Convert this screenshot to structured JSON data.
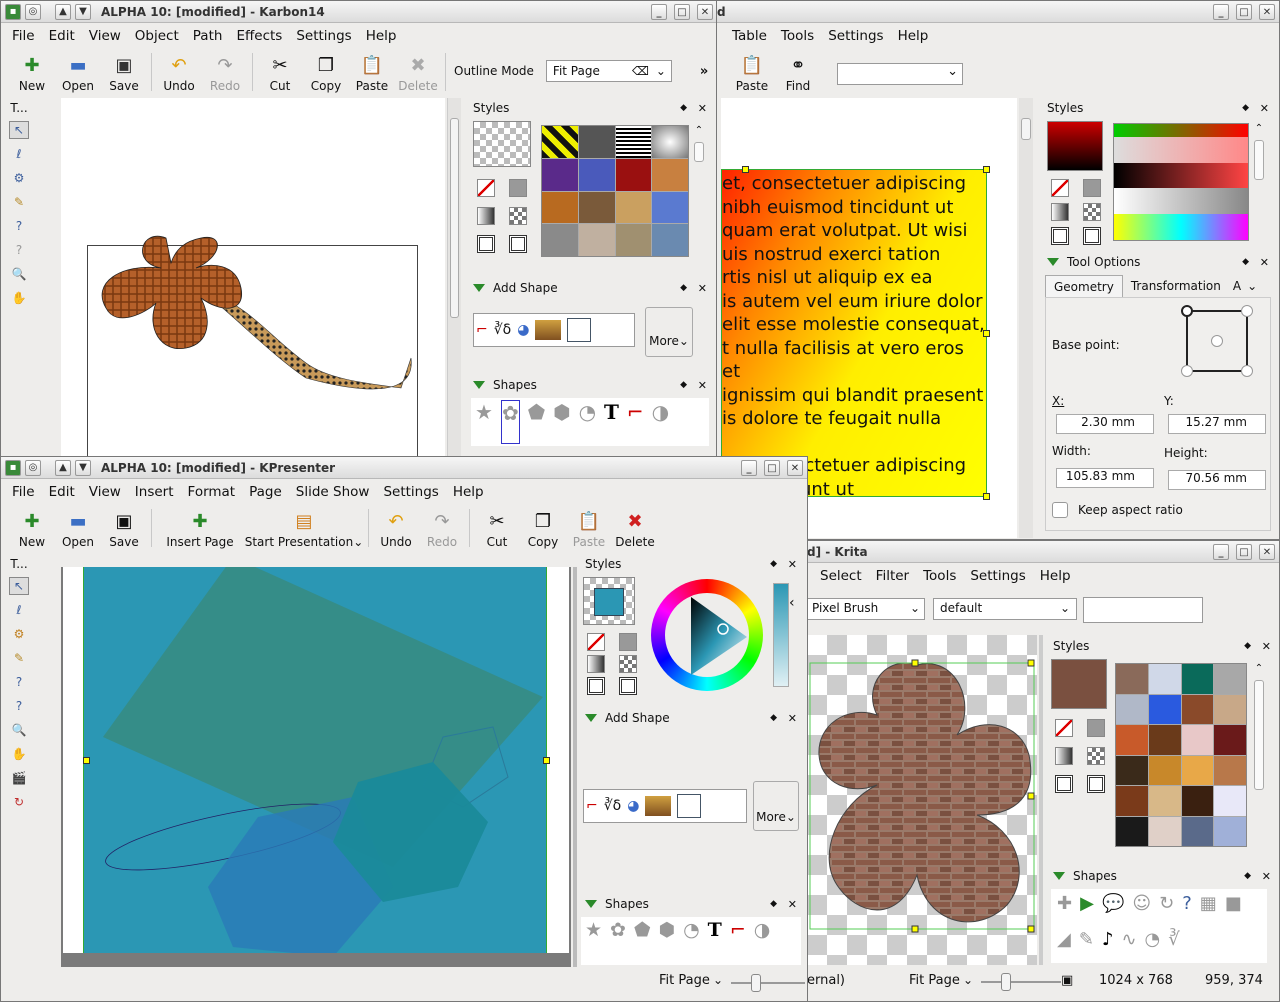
{
  "karbon": {
    "title": "ALPHA 10:  [modified] - Karbon14",
    "menu": [
      "File",
      "Edit",
      "View",
      "Object",
      "Path",
      "Effects",
      "Settings",
      "Help"
    ],
    "toolbar": [
      {
        "label": "New",
        "icon": "new-icon",
        "disabled": false
      },
      {
        "label": "Open",
        "icon": "open-icon",
        "disabled": false
      },
      {
        "label": "Save",
        "icon": "save-icon",
        "disabled": false
      },
      {
        "label": "Undo",
        "icon": "undo-icon",
        "disabled": false
      },
      {
        "label": "Redo",
        "icon": "redo-icon",
        "disabled": true
      },
      {
        "label": "Cut",
        "icon": "cut-icon",
        "disabled": false
      },
      {
        "label": "Copy",
        "icon": "copy-icon",
        "disabled": false
      },
      {
        "label": "Paste",
        "icon": "paste-icon",
        "disabled": false
      },
      {
        "label": "Delete",
        "icon": "delete-icon",
        "disabled": true
      }
    ],
    "outline_mode_label": "Outline Mode",
    "zoom_value": "Fit Page",
    "overflow": "»",
    "toolbox_label": "T...",
    "dock_styles": "Styles",
    "dock_add_shape": "Add Shape",
    "dock_shapes": "Shapes",
    "more_label": "More"
  },
  "kword": {
    "title_tail": "d",
    "menu": [
      "Table",
      "Tools",
      "Settings",
      "Help"
    ],
    "toolbar": [
      {
        "label": "Paste",
        "icon": "paste-icon"
      },
      {
        "label": "Find",
        "icon": "binoculars-icon"
      }
    ],
    "text_lines": [
      "et, consectetuer adipiscing",
      "nibh euismod tincidunt ut",
      "quam erat volutpat. Ut wisi",
      "uis nostrud exerci tation",
      "rtis nisl ut aliquip ex ea",
      "is autem vel eum iriure dolor",
      "elit esse molestie consequat,",
      "t nulla facilisis at vero eros et",
      "ignissim qui blandit praesent",
      "is dolore te feugait nulla",
      "",
      "et, consectetuer adipiscing",
      "od tincidunt ut"
    ],
    "dock_styles": "Styles",
    "tool_options": "Tool Options",
    "tabs": [
      "Geometry",
      "Transformation",
      "A"
    ],
    "base_point": "Base point:",
    "x_label": "X:",
    "y_label": "Y:",
    "x_value": "2.30 mm",
    "y_value": "15.27 mm",
    "width_label": "Width:",
    "height_label": "Height:",
    "width_value": "105.83 mm",
    "height_value": "70.56 mm",
    "keep_aspect": "Keep aspect ratio"
  },
  "kpresenter": {
    "title": "ALPHA 10:  [modified] - KPresenter",
    "menu": [
      "File",
      "Edit",
      "View",
      "Insert",
      "Format",
      "Page",
      "Slide Show",
      "Settings",
      "Help"
    ],
    "toolbar": [
      {
        "label": "New",
        "icon": "new-icon",
        "disabled": false
      },
      {
        "label": "Open",
        "icon": "open-icon",
        "disabled": false
      },
      {
        "label": "Save",
        "icon": "save-icon",
        "disabled": false
      },
      {
        "label": "Insert Page",
        "icon": "insert-page-icon",
        "disabled": false
      },
      {
        "label": "Start Presentation",
        "icon": "presentation-icon",
        "disabled": false
      },
      {
        "label": "Undo",
        "icon": "undo-icon",
        "disabled": false
      },
      {
        "label": "Redo",
        "icon": "redo-icon",
        "disabled": true
      },
      {
        "label": "Cut",
        "icon": "cut-icon",
        "disabled": false
      },
      {
        "label": "Copy",
        "icon": "copy-icon",
        "disabled": false
      },
      {
        "label": "Paste",
        "icon": "paste-icon",
        "disabled": true
      },
      {
        "label": "Delete",
        "icon": "delete-icon",
        "disabled": false
      }
    ],
    "toolbox_label": "T...",
    "dock_styles": "Styles",
    "dock_add_shape": "Add Shape",
    "dock_shapes": "Shapes",
    "more_label": "More",
    "zoom_status": "Fit Page"
  },
  "krita": {
    "title_tail": "d] - Krita",
    "menu": [
      "Select",
      "Filter",
      "Tools",
      "Settings",
      "Help"
    ],
    "brush": "Pixel Brush",
    "preset": "default",
    "dock_styles": "Styles",
    "dock_shapes": "Shapes",
    "status_left": "ernal)",
    "zoom_status": "Fit Page",
    "image_size": "1024 x 768",
    "cursor_pos": "959, 374"
  },
  "colors": {
    "accent_green": "#2a8a2a",
    "slide_teal": "#2b97b4",
    "handle_yellow": "#ffff00"
  }
}
